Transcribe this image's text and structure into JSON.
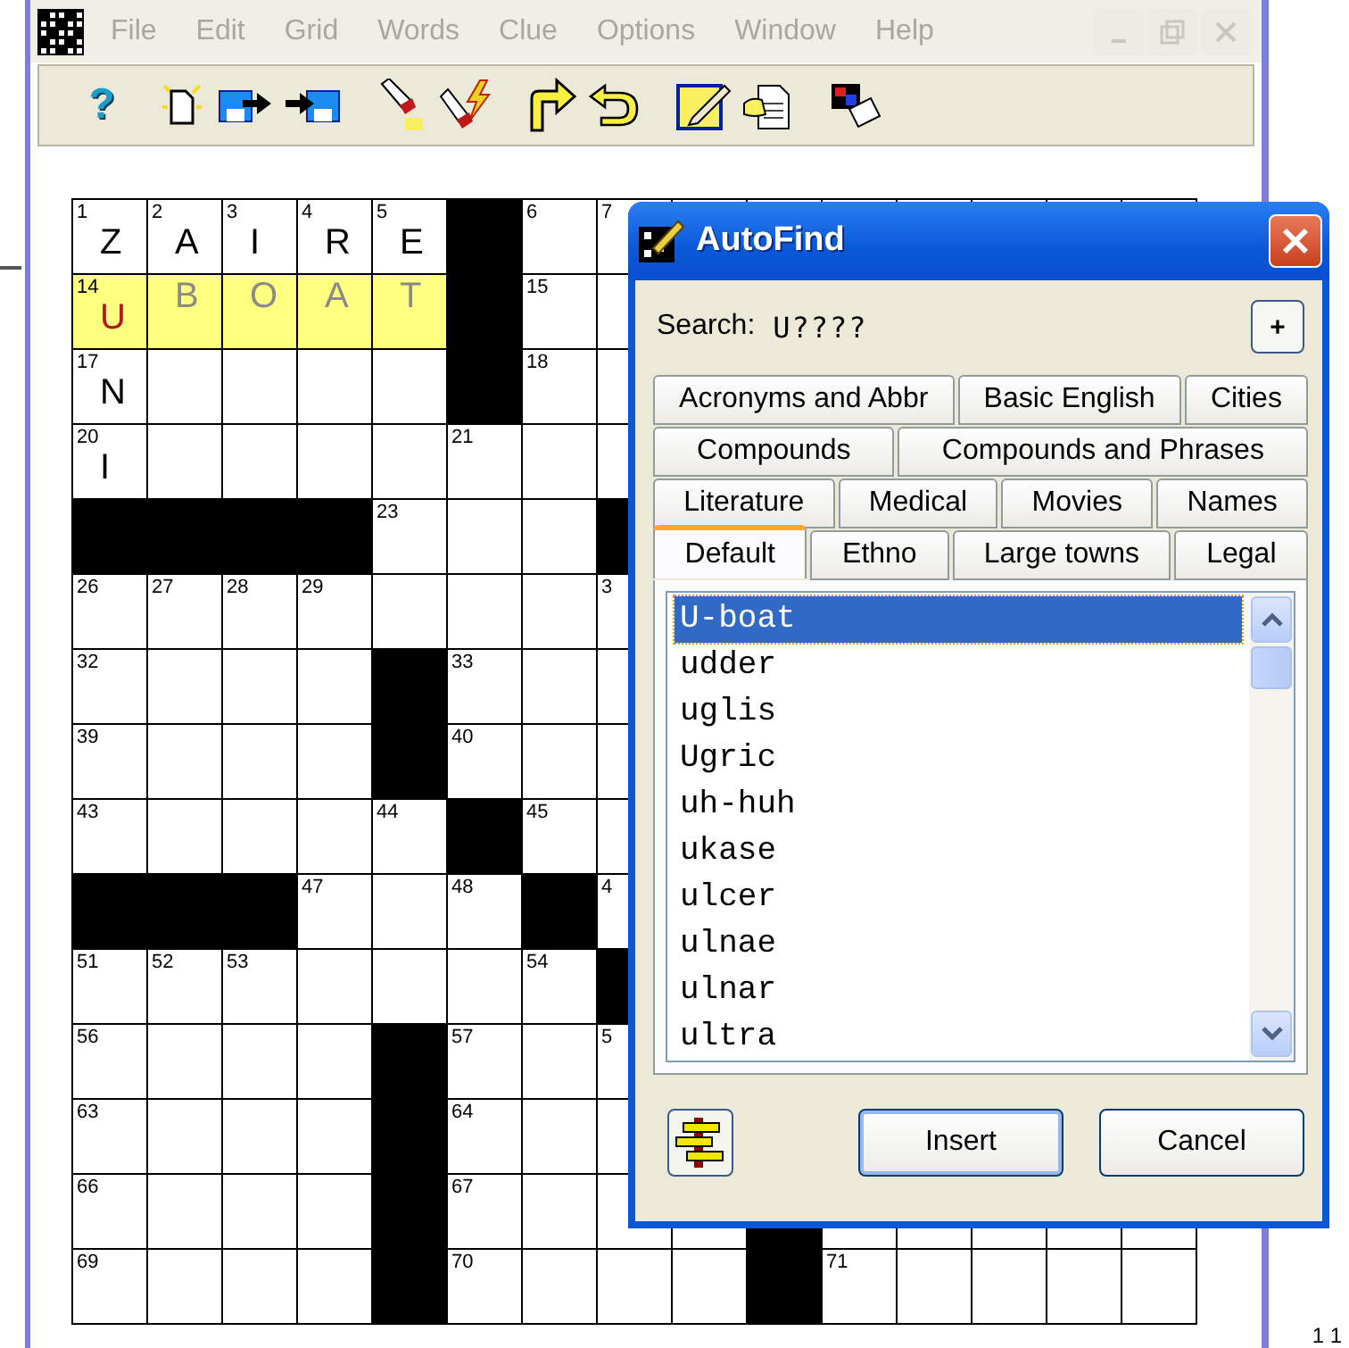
{
  "menu_bar": {
    "items": [
      "File",
      "Edit",
      "Grid",
      "Words",
      "Clue",
      "Options",
      "Window",
      "Help"
    ]
  },
  "toolbar": {
    "help_glyph": "?"
  },
  "grid": {
    "rows": [
      {
        "cells": [
          {
            "kind": "white",
            "number": "1",
            "letter": {
              "text": "Z",
              "kind": "entered"
            },
            "highlighted": false
          },
          {
            "kind": "white",
            "number": "2",
            "letter": {
              "text": "A",
              "kind": "entered"
            },
            "highlighted": false
          },
          {
            "kind": "white",
            "number": "3",
            "letter": {
              "text": "I",
              "kind": "entered"
            },
            "highlighted": false
          },
          {
            "kind": "white",
            "number": "4",
            "letter": {
              "text": "R",
              "kind": "entered"
            },
            "highlighted": false
          },
          {
            "kind": "white",
            "number": "5",
            "letter": {
              "text": "E",
              "kind": "entered"
            },
            "highlighted": false
          },
          {
            "kind": "black"
          },
          {
            "kind": "white",
            "number": "6",
            "highlighted": false
          },
          {
            "kind": "white",
            "number": "7",
            "highlighted": false
          }
        ]
      },
      {
        "cells": [
          {
            "kind": "white",
            "number": "14",
            "letter": {
              "text": "U",
              "kind": "cursor"
            },
            "highlighted": true
          },
          {
            "kind": "white",
            "letter": {
              "text": "B",
              "kind": "preview"
            },
            "highlighted": true
          },
          {
            "kind": "white",
            "letter": {
              "text": "O",
              "kind": "preview"
            },
            "highlighted": true
          },
          {
            "kind": "white",
            "letter": {
              "text": "A",
              "kind": "preview"
            },
            "highlighted": true
          },
          {
            "kind": "white",
            "letter": {
              "text": "T",
              "kind": "preview"
            },
            "highlighted": true
          },
          {
            "kind": "black"
          },
          {
            "kind": "white",
            "number": "15",
            "highlighted": false
          },
          {
            "kind": "white",
            "highlighted": false
          }
        ]
      },
      {
        "cells": [
          {
            "kind": "white",
            "number": "17",
            "letter": {
              "text": "N",
              "kind": "entered"
            },
            "highlighted": false
          },
          {
            "kind": "white",
            "highlighted": false
          },
          {
            "kind": "white",
            "highlighted": false
          },
          {
            "kind": "white",
            "highlighted": false
          },
          {
            "kind": "white",
            "highlighted": false
          },
          {
            "kind": "black"
          },
          {
            "kind": "white",
            "number": "18",
            "highlighted": false
          },
          {
            "kind": "white",
            "highlighted": false
          }
        ]
      },
      {
        "cells": [
          {
            "kind": "white",
            "number": "20",
            "letter": {
              "text": "I",
              "kind": "entered"
            },
            "highlighted": false
          },
          {
            "kind": "white",
            "highlighted": false
          },
          {
            "kind": "white",
            "highlighted": false
          },
          {
            "kind": "white",
            "highlighted": false
          },
          {
            "kind": "white",
            "highlighted": false
          },
          {
            "kind": "white",
            "number": "21",
            "highlighted": false
          },
          {
            "kind": "white",
            "highlighted": false
          },
          {
            "kind": "white",
            "highlighted": false
          }
        ]
      },
      {
        "cells": [
          {
            "kind": "black"
          },
          {
            "kind": "black"
          },
          {
            "kind": "black"
          },
          {
            "kind": "black"
          },
          {
            "kind": "white",
            "number": "23",
            "highlighted": false
          },
          {
            "kind": "white",
            "highlighted": false
          },
          {
            "kind": "white",
            "highlighted": false
          },
          {
            "kind": "black"
          }
        ]
      },
      {
        "cells": [
          {
            "kind": "white",
            "number": "26",
            "highlighted": false
          },
          {
            "kind": "white",
            "number": "27",
            "highlighted": false
          },
          {
            "kind": "white",
            "number": "28",
            "highlighted": false
          },
          {
            "kind": "white",
            "number": "29",
            "highlighted": false
          },
          {
            "kind": "white",
            "highlighted": false
          },
          {
            "kind": "white",
            "highlighted": false
          },
          {
            "kind": "white",
            "highlighted": false
          },
          {
            "kind": "white",
            "number": "3",
            "highlighted": false
          }
        ]
      },
      {
        "cells": [
          {
            "kind": "white",
            "number": "32",
            "highlighted": false
          },
          {
            "kind": "white",
            "highlighted": false
          },
          {
            "kind": "white",
            "highlighted": false
          },
          {
            "kind": "white",
            "highlighted": false
          },
          {
            "kind": "black"
          },
          {
            "kind": "white",
            "number": "33",
            "highlighted": false
          },
          {
            "kind": "white",
            "highlighted": false
          },
          {
            "kind": "white",
            "highlighted": false
          }
        ]
      },
      {
        "cells": [
          {
            "kind": "white",
            "number": "39",
            "highlighted": false
          },
          {
            "kind": "white",
            "highlighted": false
          },
          {
            "kind": "white",
            "highlighted": false
          },
          {
            "kind": "white",
            "highlighted": false
          },
          {
            "kind": "black"
          },
          {
            "kind": "white",
            "number": "40",
            "highlighted": false
          },
          {
            "kind": "white",
            "highlighted": false
          },
          {
            "kind": "white",
            "highlighted": false
          }
        ]
      },
      {
        "cells": [
          {
            "kind": "white",
            "number": "43",
            "highlighted": false
          },
          {
            "kind": "white",
            "highlighted": false
          },
          {
            "kind": "white",
            "highlighted": false
          },
          {
            "kind": "white",
            "highlighted": false
          },
          {
            "kind": "white",
            "number": "44",
            "highlighted": false
          },
          {
            "kind": "black"
          },
          {
            "kind": "white",
            "number": "45",
            "highlighted": false
          },
          {
            "kind": "white",
            "highlighted": false
          }
        ]
      },
      {
        "cells": [
          {
            "kind": "black"
          },
          {
            "kind": "black"
          },
          {
            "kind": "black"
          },
          {
            "kind": "white",
            "number": "47",
            "highlighted": false
          },
          {
            "kind": "white",
            "highlighted": false
          },
          {
            "kind": "white",
            "number": "48",
            "highlighted": false
          },
          {
            "kind": "black"
          },
          {
            "kind": "white",
            "number": "4",
            "highlighted": false
          }
        ]
      },
      {
        "cells": [
          {
            "kind": "white",
            "number": "51",
            "highlighted": false
          },
          {
            "kind": "white",
            "number": "52",
            "highlighted": false
          },
          {
            "kind": "white",
            "number": "53",
            "highlighted": false
          },
          {
            "kind": "white",
            "highlighted": false
          },
          {
            "kind": "white",
            "highlighted": false
          },
          {
            "kind": "white",
            "highlighted": false
          },
          {
            "kind": "white",
            "number": "54",
            "highlighted": false
          },
          {
            "kind": "black"
          }
        ]
      },
      {
        "cells": [
          {
            "kind": "white",
            "number": "56",
            "highlighted": false
          },
          {
            "kind": "white",
            "highlighted": false
          },
          {
            "kind": "white",
            "highlighted": false
          },
          {
            "kind": "white",
            "highlighted": false
          },
          {
            "kind": "black"
          },
          {
            "kind": "white",
            "number": "57",
            "highlighted": false
          },
          {
            "kind": "white",
            "highlighted": false
          },
          {
            "kind": "white",
            "number": "5",
            "highlighted": false
          }
        ]
      },
      {
        "cells": [
          {
            "kind": "white",
            "number": "63",
            "highlighted": false
          },
          {
            "kind": "white",
            "highlighted": false
          },
          {
            "kind": "white",
            "highlighted": false
          },
          {
            "kind": "white",
            "highlighted": false
          },
          {
            "kind": "black"
          },
          {
            "kind": "white",
            "number": "64",
            "highlighted": false
          },
          {
            "kind": "white",
            "highlighted": false
          },
          {
            "kind": "white",
            "highlighted": false
          }
        ]
      },
      {
        "cells": [
          {
            "kind": "white",
            "number": "66",
            "highlighted": false
          },
          {
            "kind": "white",
            "highlighted": false
          },
          {
            "kind": "white",
            "highlighted": false
          },
          {
            "kind": "white",
            "highlighted": false
          },
          {
            "kind": "black"
          },
          {
            "kind": "white",
            "number": "67",
            "highlighted": false
          },
          {
            "kind": "white",
            "highlighted": false
          },
          {
            "kind": "white",
            "highlighted": false
          },
          {
            "kind": "white",
            "highlighted": false
          },
          {
            "kind": "black"
          },
          {
            "kind": "white",
            "highlighted": false
          },
          {
            "kind": "white",
            "highlighted": false
          },
          {
            "kind": "white",
            "highlighted": false
          },
          {
            "kind": "white",
            "highlighted": false
          },
          {
            "kind": "white",
            "highlighted": false
          }
        ]
      },
      {
        "cells": [
          {
            "kind": "white",
            "number": "69",
            "highlighted": false
          },
          {
            "kind": "white",
            "highlighted": false
          },
          {
            "kind": "white",
            "highlighted": false
          },
          {
            "kind": "white",
            "highlighted": false
          },
          {
            "kind": "black"
          },
          {
            "kind": "white",
            "number": "70",
            "highlighted": false
          },
          {
            "kind": "white",
            "highlighted": false
          },
          {
            "kind": "white",
            "highlighted": false
          },
          {
            "kind": "white",
            "highlighted": false
          },
          {
            "kind": "black"
          },
          {
            "kind": "white",
            "number": "71",
            "highlighted": false
          },
          {
            "kind": "white",
            "highlighted": false
          },
          {
            "kind": "white",
            "highlighted": false
          },
          {
            "kind": "white",
            "highlighted": false
          },
          {
            "kind": "white",
            "highlighted": false
          }
        ]
      }
    ]
  },
  "dialog": {
    "title": "AutoFind",
    "search_label": "Search:",
    "search_value": "U????",
    "add_button": "+",
    "tab_rows": [
      [
        {
          "label": "Acronyms and Abbr",
          "selected": false
        },
        {
          "label": "Basic English",
          "selected": false
        },
        {
          "label": "Cities",
          "selected": false
        }
      ],
      [
        {
          "label": "Compounds",
          "selected": false
        },
        {
          "label": "Compounds and Phrases",
          "selected": false
        }
      ],
      [
        {
          "label": "Literature",
          "selected": false
        },
        {
          "label": "Medical",
          "selected": false
        },
        {
          "label": "Movies",
          "selected": false
        },
        {
          "label": "Names",
          "selected": false
        }
      ],
      [
        {
          "label": "Default",
          "selected": true
        },
        {
          "label": "Ethno",
          "selected": false
        },
        {
          "label": "Large towns",
          "selected": false
        },
        {
          "label": "Legal",
          "selected": false
        }
      ]
    ],
    "results": [
      {
        "text": "U-boat",
        "selected": true
      },
      {
        "text": "udder",
        "selected": false
      },
      {
        "text": "uglis",
        "selected": false
      },
      {
        "text": "Ugric",
        "selected": false
      },
      {
        "text": "uh-huh",
        "selected": false
      },
      {
        "text": "ukase",
        "selected": false
      },
      {
        "text": "ulcer",
        "selected": false
      },
      {
        "text": "ulnae",
        "selected": false
      },
      {
        "text": "ulnar",
        "selected": false
      },
      {
        "text": "ultra",
        "selected": false
      }
    ],
    "buttons": [
      "Insert",
      "Cancel"
    ]
  },
  "corner_text": "1 1"
}
